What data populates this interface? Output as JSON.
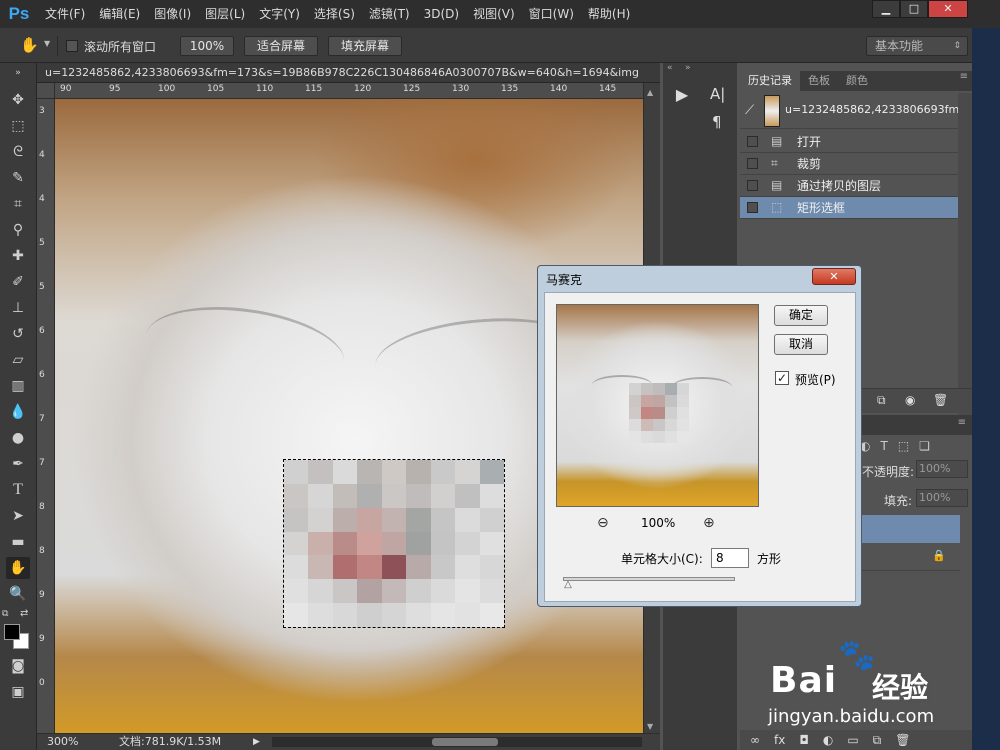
{
  "app": {
    "logo": "Ps"
  },
  "menu": [
    "文件(F)",
    "编辑(E)",
    "图像(I)",
    "图层(L)",
    "文字(Y)",
    "选择(S)",
    "滤镜(T)",
    "3D(D)",
    "视图(V)",
    "窗口(W)",
    "帮助(H)"
  ],
  "window_controls": {
    "minimize": "▁",
    "maximize": "□",
    "close": "✕"
  },
  "options": {
    "scroll_all_label": "滚动所有窗口",
    "zoom_btn": "100%",
    "fit_screen": "适合屏幕",
    "fill_screen": "填充屏幕",
    "workspace": "基本功能"
  },
  "document": {
    "tab_title": "u=1232485862,4233806693&fm=173&s=19B86B978C226C130486846A0300707B&w=640&h=1694&img",
    "ruler_top": [
      "90",
      "95",
      "100",
      "105",
      "110",
      "115",
      "120",
      "125",
      "130",
      "135",
      "140",
      "145"
    ],
    "ruler_left": [
      "3",
      "4",
      "4",
      "5",
      "5",
      "6",
      "6",
      "7",
      "7",
      "8",
      "8",
      "9",
      "9",
      "0"
    ],
    "zoom": "300%",
    "doc_size": "文档:781.9K/1.53M"
  },
  "history": {
    "tabs": [
      "历史记录",
      "色板",
      "颜色"
    ],
    "snapshot": "u=1232485862,4233806693fm...",
    "items": [
      {
        "label": "打开",
        "icon": "document-icon"
      },
      {
        "label": "裁剪",
        "icon": "crop-icon"
      },
      {
        "label": "通过拷贝的图层",
        "icon": "document-icon"
      },
      {
        "label": "矩形选框",
        "icon": "marquee-icon"
      }
    ]
  },
  "layers": {
    "opacity_label": "不透明度:",
    "opacity_value": "100%",
    "fill_label": "填充:",
    "fill_value": "100%"
  },
  "dialog": {
    "title": "马赛克",
    "ok": "确定",
    "cancel": "取消",
    "preview_label": "预览(P)",
    "preview_checked": true,
    "zoom": "100%",
    "cell_size_label": "单元格大小(C):",
    "cell_size_value": "8",
    "cell_unit": "方形",
    "cell_size_slider": 0.03
  },
  "colors": {
    "accent_selection": "#6e8bae",
    "ps_blue": "#3da8f5"
  },
  "watermark": {
    "brand_text": "Bai",
    "brand_suffix": "经验",
    "url": "jingyan.baidu.com"
  }
}
